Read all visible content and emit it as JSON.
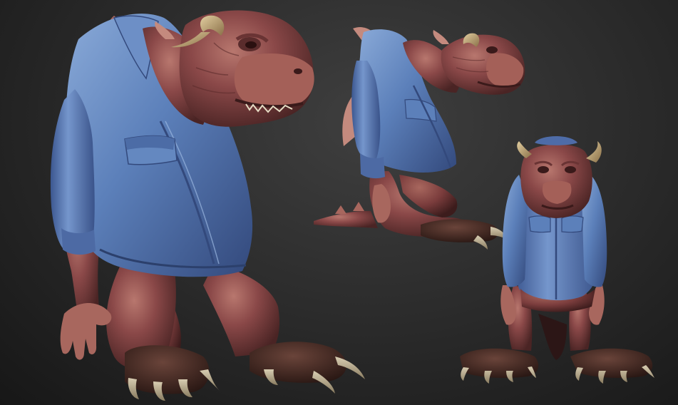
{
  "scene": {
    "subject": "creature-sculpt",
    "views": [
      {
        "view": "three-quarter"
      },
      {
        "view": "side"
      },
      {
        "view": "front"
      }
    ]
  },
  "colors": {
    "background_center": "#3f3f3f",
    "background_edge": "#171717",
    "skin": "#8a4848",
    "skin_dark": "#5a2e2e",
    "skin_light": "#b77a70",
    "shirt": "#5a7eb8",
    "shirt_dark": "#38528a",
    "shirt_light": "#86a6d6",
    "horn": "#c9b080",
    "claw": "#c8bca0",
    "foot": "#4a2c26"
  }
}
